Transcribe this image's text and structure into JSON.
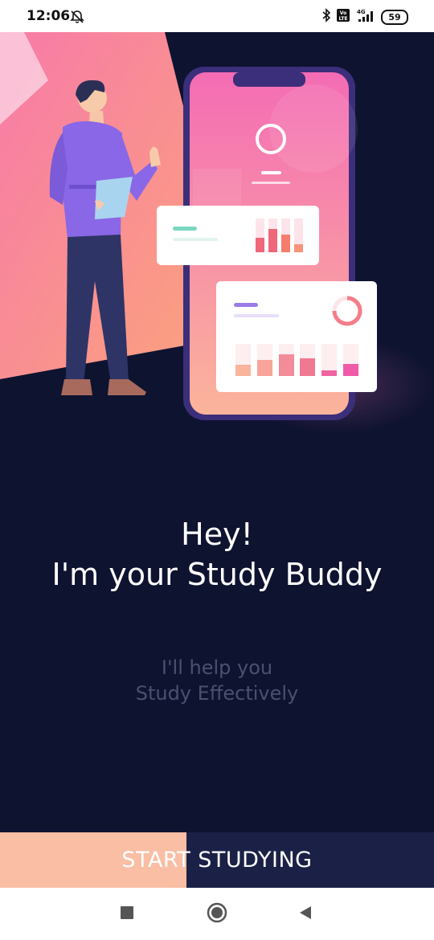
{
  "status_bar": {
    "time": "12:06",
    "battery": "59",
    "network": "4G",
    "volte": "Vo LTE"
  },
  "hero": {
    "illustration": "person-with-phone-charts-illustration"
  },
  "welcome": {
    "line1": "Hey!",
    "line2": "I'm your Study Buddy",
    "sub1": "I'll help you",
    "sub2": "Study Effectively"
  },
  "start_button": {
    "label": "START STUDYING",
    "progress_percent": 43
  },
  "nav": {
    "recents": "square-icon",
    "home": "circle-icon",
    "back": "triangle-back-icon"
  },
  "colors": {
    "background": "#0e1330",
    "button_fill": "#f9bea4",
    "button_bg": "#1b2146",
    "accent_pink": "#f472b6"
  }
}
